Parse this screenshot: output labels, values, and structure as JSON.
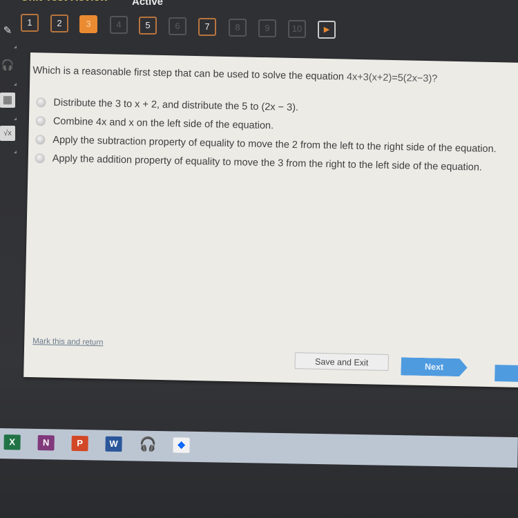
{
  "header": {
    "title": "Unit Test Review",
    "status": "Active"
  },
  "question_nav": {
    "items": [
      {
        "label": "1",
        "state": "answered"
      },
      {
        "label": "2",
        "state": "answered"
      },
      {
        "label": "3",
        "state": "current"
      },
      {
        "label": "4",
        "state": "locked"
      },
      {
        "label": "5",
        "state": "answered"
      },
      {
        "label": "6",
        "state": "locked"
      },
      {
        "label": "7",
        "state": "answered"
      },
      {
        "label": "8",
        "state": "locked"
      },
      {
        "label": "9",
        "state": "locked"
      },
      {
        "label": "10",
        "state": "locked"
      }
    ],
    "next_icon": "▶"
  },
  "left_rail": {
    "icons": [
      "pencil-icon",
      "headphones-icon",
      "calculator-icon",
      "math-formula-icon"
    ],
    "glyphs": [
      "✎",
      "🎧",
      "▦",
      "√x"
    ]
  },
  "question": {
    "prompt": "Which is a reasonable first step that can be used to solve the equation",
    "equation": "4x+3(x+2)=5(2x−3)?",
    "options": [
      "Distribute the 3 to x + 2, and distribute the 5 to (2x − 3).",
      "Combine 4x and x on the left side of the equation.",
      "Apply the subtraction property of equality to move the 2 from the left to the right side of the equation.",
      "Apply the addition property of equality to move the 3 from the right to the left side of the equation."
    ]
  },
  "footer": {
    "mark_link": "Mark this and return",
    "save_label": "Save and Exit",
    "next_label": "Next"
  },
  "taskbar": {
    "apps": [
      {
        "name": "Excel",
        "glyph": "X"
      },
      {
        "name": "OneNote",
        "glyph": "N"
      },
      {
        "name": "PowerPoint",
        "glyph": "P"
      },
      {
        "name": "Word",
        "glyph": "W"
      },
      {
        "name": "Audacity",
        "glyph": "🎧"
      },
      {
        "name": "Dropbox",
        "glyph": "❖"
      }
    ]
  },
  "colors": {
    "accent_orange": "#ea8a31",
    "next_blue": "#4f9be0",
    "title_yellow": "#d8c46a"
  }
}
